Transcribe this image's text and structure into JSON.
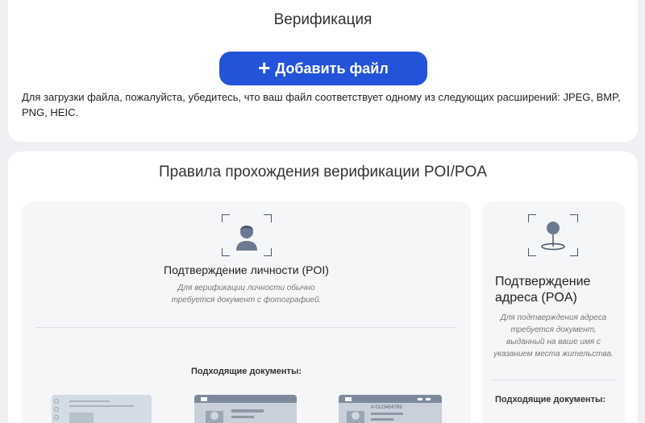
{
  "verification": {
    "title": "Верификация",
    "add_file_label": "Добавить файл",
    "upload_hint": "Для загрузки файла, пожалуйста, убедитесь, что ваш файл соответствует одному из следующих расширений: JPEG, BMP, PNG, HEIC."
  },
  "rules": {
    "title": "Правила прохождения верификации POI/POA",
    "poi": {
      "icon": "person-id-icon",
      "title": "Подтверждение личности (POI)",
      "description": "Для верификации личности обычно требуется документ с фотографией.",
      "docs_label": "Подходящие документы:",
      "documents": [
        {
          "icon": "passport-icon"
        },
        {
          "icon": "id-card-icon"
        },
        {
          "icon": "driver-license-icon",
          "number": "A 0123456789"
        }
      ]
    },
    "poa": {
      "icon": "location-pin-icon",
      "title": "Подтверждение адреса (POA)",
      "description": "Для подтверждения адреса требуется документ, выданный на ваше имя с указанием места жительства.",
      "docs_label": "Подходящие документы:"
    }
  },
  "colors": {
    "accent": "#2353d9",
    "background": "#eef0f3",
    "card": "#ffffff",
    "subcard": "#f5f6f8",
    "icon": "#6b7a90"
  }
}
